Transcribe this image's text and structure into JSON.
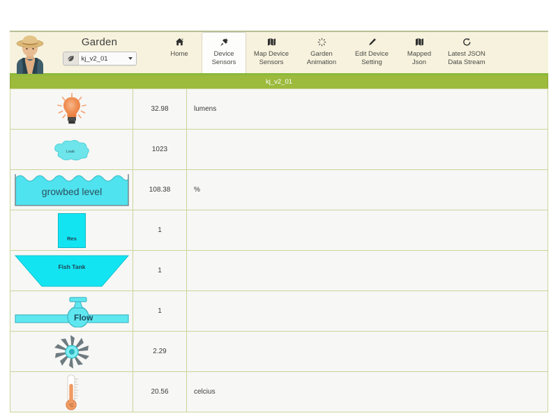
{
  "header": {
    "brand_title": "Garden",
    "avatar_name": "farmer-avatar",
    "device_select": {
      "addon_icon": "leaf-icon",
      "value": "kj_v2_01",
      "caret_icon": "chevron-down-icon"
    },
    "nav": [
      {
        "icon": "home-icon",
        "glyph": "⌂",
        "line1": "Home",
        "line2": "",
        "active": false
      },
      {
        "icon": "plug-icon",
        "glyph": "⚡",
        "line1": "Device",
        "line2": "Sensors",
        "active": true
      },
      {
        "icon": "map-icon",
        "glyph": "◧",
        "line1": "Map Device",
        "line2": "Sensors",
        "active": false
      },
      {
        "icon": "sun-icon",
        "glyph": "☼",
        "line1": "Garden",
        "line2": "Animation",
        "active": false
      },
      {
        "icon": "pencil-icon",
        "glyph": "✐",
        "line1": "Edit Device",
        "line2": "Setting",
        "active": false
      },
      {
        "icon": "map-icon",
        "glyph": "◧",
        "line1": "Mapped",
        "line2": "Json",
        "active": false
      },
      {
        "icon": "history-icon",
        "glyph": "↺",
        "line1": "Latest JSON",
        "line2": "Data Stream",
        "active": false
      }
    ]
  },
  "device_bar": {
    "title": "kj_v2_01"
  },
  "table": {
    "rows": [
      {
        "icon": "light-bulb-icon",
        "icon_label": "",
        "value": "32.98",
        "unit": "lumens"
      },
      {
        "icon": "leak-cloud-icon",
        "icon_label": "Leak",
        "value": "1023",
        "unit": ""
      },
      {
        "icon": "growbed-tank-icon",
        "icon_label": "growbed level",
        "value": "108.38",
        "unit": "%"
      },
      {
        "icon": "reservoir-icon",
        "icon_label": "Res",
        "value": "1",
        "unit": ""
      },
      {
        "icon": "fish-tank-icon",
        "icon_label": "Fish Tank",
        "value": "1",
        "unit": ""
      },
      {
        "icon": "flow-valve-icon",
        "icon_label": "Flow",
        "value": "1",
        "unit": ""
      },
      {
        "icon": "impeller-icon",
        "icon_label": "",
        "value": "2.29",
        "unit": ""
      },
      {
        "icon": "thermometer-icon",
        "icon_label": "",
        "value": "20.56",
        "unit": "celcius"
      }
    ]
  },
  "colors": {
    "header_bg": "#f6f2dd",
    "accent_green": "#9cba3c",
    "table_border": "#cbd49a",
    "cell_bg": "#f7f7f5",
    "cyan": "#13e4f2",
    "bulb_orange": "#f0864a"
  }
}
